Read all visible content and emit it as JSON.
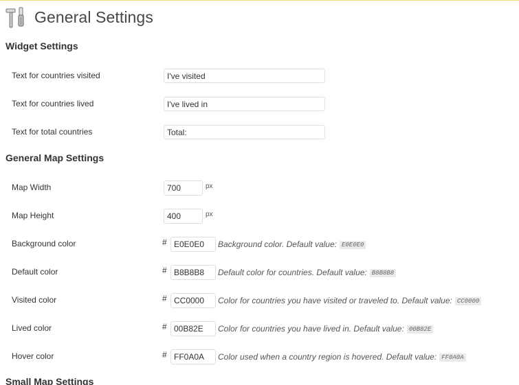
{
  "page": {
    "title": "General Settings"
  },
  "widget_settings": {
    "heading": "Widget Settings",
    "rows": [
      {
        "label": "Text for countries visited",
        "value": "I've visited"
      },
      {
        "label": "Text for countries lived",
        "value": "I've lived in"
      },
      {
        "label": "Text for total countries",
        "value": "Total:"
      }
    ]
  },
  "general_map_settings": {
    "heading": "General Map Settings",
    "width": {
      "label": "Map Width",
      "value": "700",
      "unit": "px"
    },
    "height": {
      "label": "Map Height",
      "value": "400",
      "unit": "px"
    },
    "colors": [
      {
        "label": "Background color",
        "hash": "#",
        "value": "E0E0E0",
        "description": "Background color. Default value:",
        "default": "E0E0E0"
      },
      {
        "label": "Default color",
        "hash": "#",
        "value": "B8B8B8",
        "description": "Default color for countries. Default value:",
        "default": "B8B8B8"
      },
      {
        "label": "Visited color",
        "hash": "#",
        "value": "CC0000",
        "description": "Color for countries you have visited or traveled to. Default value:",
        "default": "CC0000"
      },
      {
        "label": "Lived color",
        "hash": "#",
        "value": "00B82E",
        "description": "Color for countries you have lived in. Default value:",
        "default": "00B82E"
      },
      {
        "label": "Hover color",
        "hash": "#",
        "value": "FF0A0A",
        "description": "Color used when a country region is hovered. Default value:",
        "default": "FF0A0A"
      }
    ]
  },
  "small_map_settings": {
    "heading": "Small Map Settings"
  },
  "icons": {
    "title_icon": "tools-icon"
  }
}
